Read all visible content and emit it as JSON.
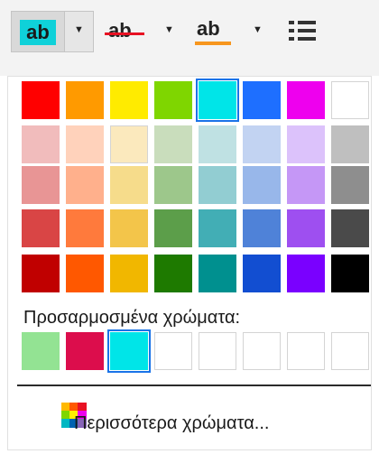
{
  "toolbar": {
    "highlight_label": "ab",
    "strike_label": "ab",
    "underline_label": "ab",
    "highlight_color": "#0fd1d9",
    "strike_color": "#e81123",
    "underline_color": "#f7961e"
  },
  "palette": {
    "rows": [
      [
        "#ff0000",
        "#ff9a00",
        "#ffeb00",
        "#7fd600",
        "#00e5e8",
        "#1e6fff",
        "#ee00ee",
        "#ffffff"
      ],
      [
        "#f1bcbc",
        "#ffd2bb",
        "#fbe9bd",
        "#c9ddbc",
        "#bfe1e3",
        "#c2d3f2",
        "#dcc2fb",
        "#bfbfbf"
      ],
      [
        "#e89595",
        "#ffb08c",
        "#f6dc8b",
        "#9dc78b",
        "#92cdd2",
        "#98b7ea",
        "#c597f6",
        "#8e8e8e"
      ],
      [
        "#d94545",
        "#ff7a3c",
        "#f3c54a",
        "#5c9e4a",
        "#42aeb5",
        "#4f82d8",
        "#9e4ff0",
        "#4a4a4a"
      ],
      [
        "#c00000",
        "#ff5800",
        "#f1b700",
        "#1e7a00",
        "#00908f",
        "#124ed1",
        "#7a00ff",
        "#000000"
      ]
    ],
    "selected": "#00e5e8"
  },
  "custom": {
    "label": "Προσαρμοσμένα χρώματα:",
    "colors": [
      "#93e393",
      "#dc0d4c",
      "#00e5e8",
      "",
      "",
      "",
      "",
      ""
    ],
    "selected": "#00e5e8"
  },
  "more_colors": {
    "label": "Περισσότερα χρώματα..."
  }
}
